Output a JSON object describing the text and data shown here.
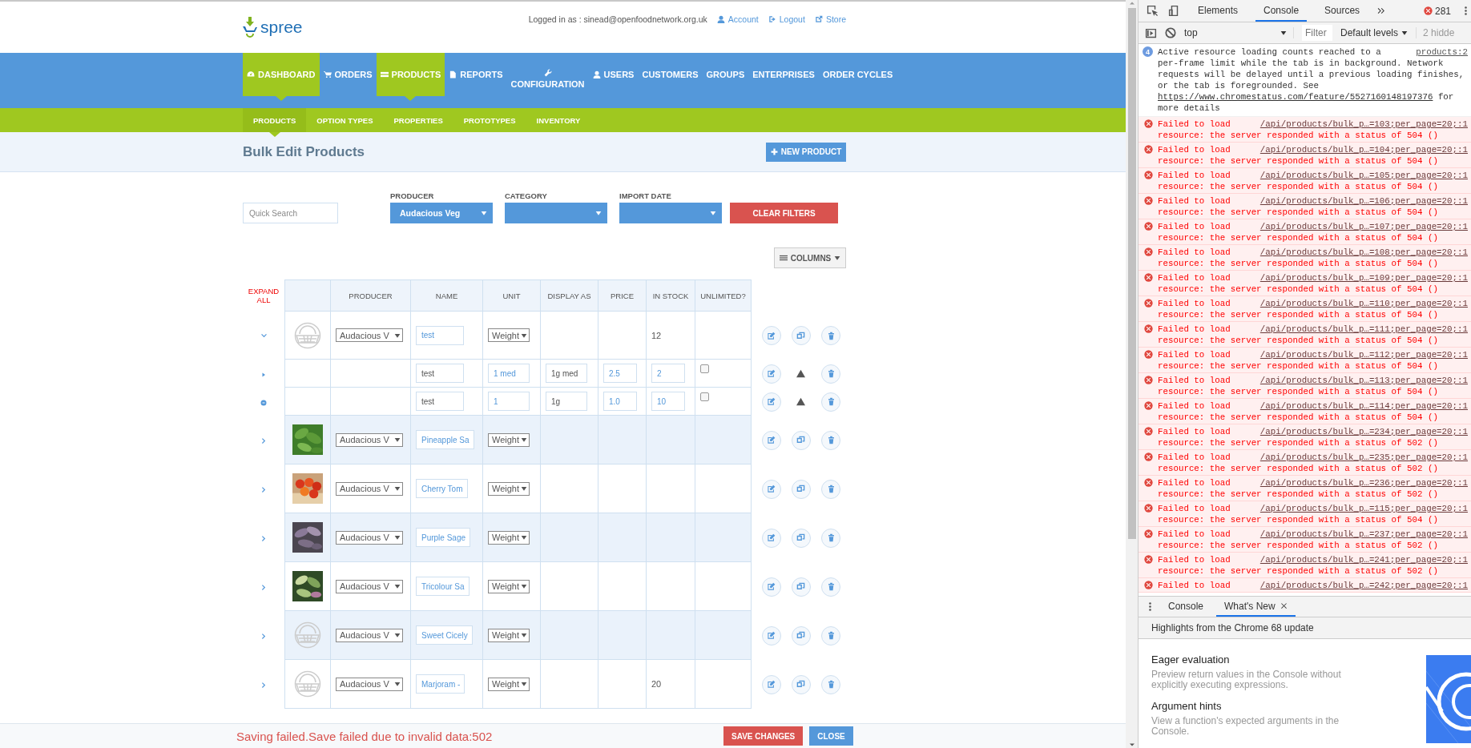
{
  "header": {
    "logo": "spree",
    "logged_in": "Logged in as : sinead@openfoodnetwork.org.uk",
    "links": [
      {
        "label": "Account",
        "kind": "user"
      },
      {
        "label": "Logout",
        "kind": "logout"
      },
      {
        "label": "Store",
        "kind": "external"
      }
    ]
  },
  "nav": [
    {
      "label": "DASHBOARD",
      "kind": "dashboard",
      "selected": true
    },
    {
      "label": "ORDERS",
      "kind": "orders",
      "selected": false
    },
    {
      "label": "PRODUCTS",
      "kind": "products",
      "selected": true
    },
    {
      "label": "REPORTS",
      "kind": "reports",
      "selected": false
    },
    {
      "label": "CONFIGURATION",
      "kind": "configuration",
      "selected": false
    },
    {
      "label": "USERS",
      "kind": "users",
      "selected": false
    },
    {
      "label": "CUSTOMERS",
      "kind": "plain",
      "selected": false
    },
    {
      "label": "GROUPS",
      "kind": "plain",
      "selected": false
    },
    {
      "label": "ENTERPRISES",
      "kind": "plain",
      "selected": false
    },
    {
      "label": "ORDER CYCLES",
      "kind": "plain",
      "selected": false
    }
  ],
  "subnav": [
    {
      "label": "PRODUCTS",
      "selected": true
    },
    {
      "label": "OPTION TYPES",
      "selected": false
    },
    {
      "label": "PROPERTIES",
      "selected": false
    },
    {
      "label": "PROTOTYPES",
      "selected": false
    },
    {
      "label": "INVENTORY",
      "selected": false
    }
  ],
  "page_title": "Bulk Edit Products",
  "new_button": "NEW PRODUCT",
  "filters": {
    "search": {
      "placeholder": "Quick Search"
    },
    "selects": [
      {
        "label": "PRODUCER",
        "value": "Audacious Veg"
      },
      {
        "label": "CATEGORY"
      },
      {
        "label": "IMPORT DATE"
      }
    ],
    "clear_button": "CLEAR FILTERS"
  },
  "columns_button": "COLUMNS",
  "table": {
    "expand_all": "EXPAND ALL",
    "columns": [
      "PRODUCER",
      "NAME",
      "UNIT",
      "DISPLAY AS",
      "PRICE",
      "IN STOCK",
      "UNLIMITED?"
    ],
    "rows": [
      {
        "kind": "product",
        "expanded": true,
        "producer": "Audacious V",
        "name": "test",
        "unit": "Weight",
        "in_stock": "12"
      },
      {
        "kind": "variant",
        "name": "test",
        "unit_value": "1 med",
        "display_as": "1g med",
        "price": "2.5",
        "in_stock": "2",
        "unlimited": false
      },
      {
        "kind": "new_variant",
        "name": "test",
        "unit_value": "1",
        "display_as": "1g",
        "price": "1.0",
        "in_stock": "10",
        "unlimited": false
      },
      {
        "kind": "product",
        "expanded": false,
        "producer": "Audacious V",
        "name": "Pineapple Sa",
        "unit": "Weight"
      },
      {
        "kind": "product",
        "expanded": false,
        "producer": "Audacious V",
        "name": "Cherry Tom",
        "unit": "Weight"
      },
      {
        "kind": "product",
        "expanded": false,
        "producer": "Audacious V",
        "name": "Purple Sage",
        "unit": "Weight"
      },
      {
        "kind": "product",
        "expanded": false,
        "producer": "Audacious V",
        "name": "Tricolour Sa",
        "unit": "Weight"
      },
      {
        "kind": "product",
        "expanded": false,
        "producer": "Audacious V",
        "name": "Sweet Cicely",
        "unit": "Weight"
      },
      {
        "kind": "product",
        "expanded": false,
        "producer": "Audacious V",
        "name": "Marjoram -",
        "unit": "Weight",
        "in_stock": "20"
      }
    ]
  },
  "status_bar": {
    "message": "Saving failed.Save failed due to invalid data:502",
    "buttons": [
      {
        "label": "SAVE CHANGES",
        "kind": "danger"
      },
      {
        "label": "CLOSE",
        "kind": "primary"
      }
    ]
  },
  "devtools": {
    "tabs": [
      {
        "label": "Elements",
        "selected": false
      },
      {
        "label": "Console",
        "selected": true
      },
      {
        "label": "Sources",
        "selected": false
      }
    ],
    "error_count": "281",
    "context": "top",
    "filter": {
      "placeholder": "Filter"
    },
    "levels": "Default levels",
    "hidden": "2 hidde",
    "messages": [
      {
        "kind": "info",
        "count": "4",
        "first_line": "Active resource loading counts reached to a",
        "text": "per-frame limit while the tab is in background. Network requests will be delayed until a previous loading finishes, or the tab is foregrounded. See",
        "link": "https://www.chromestatus.com/feature/5527160148197376",
        "text_end": "for more details",
        "source": "products:2"
      },
      {
        "kind": "error",
        "text": "Failed to load resource: the server responded with a status of 504 ()",
        "source": "/api/products/bulk_p…=103;per_page=20;:1"
      },
      {
        "kind": "error",
        "text": "Failed to load resource: the server responded with a status of 504 ()",
        "source": "/api/products/bulk_p…=104;per_page=20;:1"
      },
      {
        "kind": "error",
        "text": "Failed to load resource: the server responded with a status of 504 ()",
        "source": "/api/products/bulk_p…=105;per_page=20;:1"
      },
      {
        "kind": "error",
        "text": "Failed to load resource: the server responded with a status of 504 ()",
        "source": "/api/products/bulk_p…=106;per_page=20;:1"
      },
      {
        "kind": "error",
        "text": "Failed to load resource: the server responded with a status of 504 ()",
        "source": "/api/products/bulk_p…=107;per_page=20;:1"
      },
      {
        "kind": "error",
        "text": "Failed to load resource: the server responded with a status of 504 ()",
        "source": "/api/products/bulk_p…=108;per_page=20;:1"
      },
      {
        "kind": "error",
        "text": "Failed to load resource: the server responded with a status of 504 ()",
        "source": "/api/products/bulk_p…=109;per_page=20;:1"
      },
      {
        "kind": "error",
        "text": "Failed to load resource: the server responded with a status of 504 ()",
        "source": "/api/products/bulk_p…=110;per_page=20;:1"
      },
      {
        "kind": "error",
        "text": "Failed to load resource: the server responded with a status of 504 ()",
        "source": "/api/products/bulk_p…=111;per_page=20;:1"
      },
      {
        "kind": "error",
        "text": "Failed to load resource: the server responded with a status of 504 ()",
        "source": "/api/products/bulk_p…=112;per_page=20;:1"
      },
      {
        "kind": "error",
        "text": "Failed to load resource: the server responded with a status of 504 ()",
        "source": "/api/products/bulk_p…=113;per_page=20;:1"
      },
      {
        "kind": "error",
        "text": "Failed to load resource: the server responded with a status of 504 ()",
        "source": "/api/products/bulk_p…=114;per_page=20;:1"
      },
      {
        "kind": "error",
        "text": "Failed to load resource: the server responded with a status of 502 ()",
        "source": "/api/products/bulk_p…=234;per_page=20;:1"
      },
      {
        "kind": "error",
        "text": "Failed to load resource: the server responded with a status of 502 ()",
        "source": "/api/products/bulk_p…=235;per_page=20;:1"
      },
      {
        "kind": "error",
        "text": "Failed to load resource: the server responded with a status of 502 ()",
        "source": "/api/products/bulk_p…=236;per_page=20;:1"
      },
      {
        "kind": "error",
        "text": "Failed to load resource: the server responded with a status of 504 ()",
        "source": "/api/products/bulk_p…=115;per_page=20;:1"
      },
      {
        "kind": "error",
        "text": "Failed to load resource: the server responded with a status of 502 ()",
        "source": "/api/products/bulk_p…=237;per_page=20;:1"
      },
      {
        "kind": "error",
        "text": "Failed to load resource: the server responded with a status of 502 ()",
        "source": "/api/products/bulk_p…=241;per_page=20;:1"
      },
      {
        "kind": "error",
        "text": "Failed to load",
        "source": "/api/products/bulk_p…=242;per_page=20;:1"
      }
    ],
    "drawer": {
      "tabs": [
        {
          "label": "Console",
          "selected": false
        },
        {
          "label": "What's New",
          "selected": true
        }
      ],
      "highlight": "Highlights from the Chrome 68 update",
      "items": [
        {
          "title": "Eager evaluation",
          "text": "Preview return values in the Console without explicitly executing expressions."
        },
        {
          "title": "Argument hints",
          "text": "View a function's expected arguments in the Console."
        }
      ]
    }
  }
}
